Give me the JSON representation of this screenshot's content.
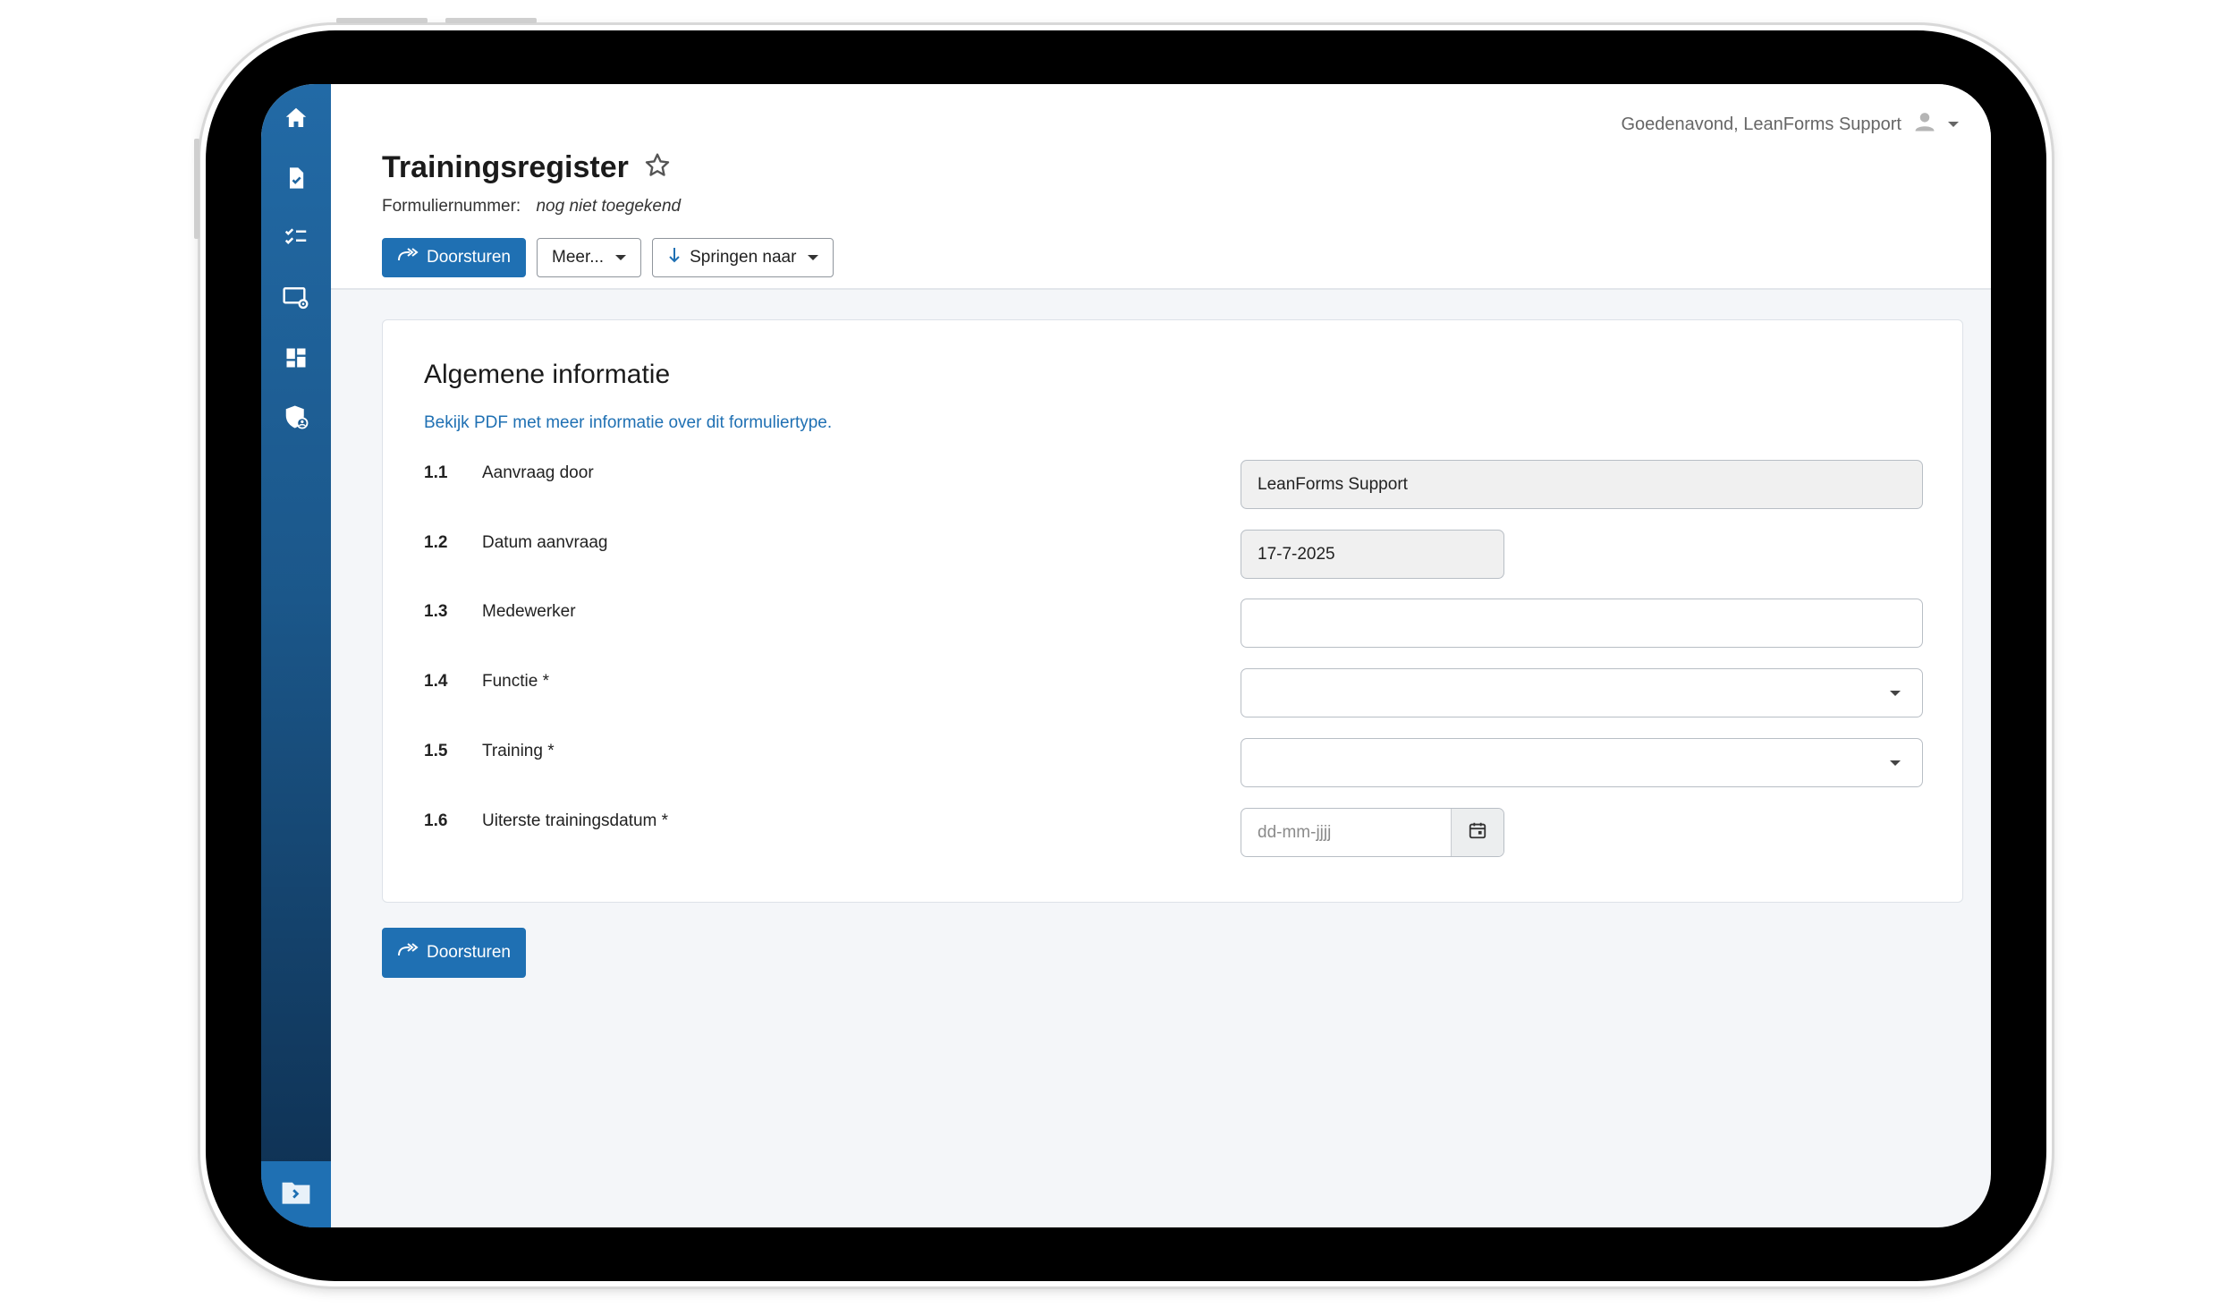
{
  "greeting": "Goedenavond, LeanForms Support",
  "page": {
    "title": "Trainingsregister",
    "form_number_label": "Formuliernummer:",
    "form_number_value": "nog niet toegekend"
  },
  "toolbar": {
    "forward_label": "Doorsturen",
    "more_label": "Meer...",
    "jump_label": "Springen naar"
  },
  "sidebar": {
    "items": [
      {
        "icon": "home-icon"
      },
      {
        "icon": "document-check-icon"
      },
      {
        "icon": "checklist-icon"
      },
      {
        "icon": "screen-settings-icon"
      },
      {
        "icon": "dashboard-icon"
      },
      {
        "icon": "shield-user-icon"
      }
    ],
    "expand_icon": "expand-sidebar-icon"
  },
  "section": {
    "title": "Algemene informatie",
    "pdf_link": "Bekijk PDF met meer informatie over dit formuliertype.",
    "fields": [
      {
        "number": "1.1",
        "label": "Aanvraag door",
        "value": "LeanForms Support"
      },
      {
        "number": "1.2",
        "label": "Datum aanvraag",
        "value": "17-7-2025"
      },
      {
        "number": "1.3",
        "label": "Medewerker",
        "value": ""
      },
      {
        "number": "1.4",
        "label": "Functie *",
        "value": ""
      },
      {
        "number": "1.5",
        "label": "Training *",
        "value": ""
      },
      {
        "number": "1.6",
        "label": "Uiterste trainingsdatum *",
        "placeholder": "dd-mm-jjjj"
      }
    ]
  },
  "bottom": {
    "forward_label": "Doorsturen"
  },
  "colors": {
    "primary": "#1f70b3",
    "sidebar_top": "#226aa6",
    "sidebar_bottom": "#0e2f50",
    "background": "#f4f6f9"
  }
}
